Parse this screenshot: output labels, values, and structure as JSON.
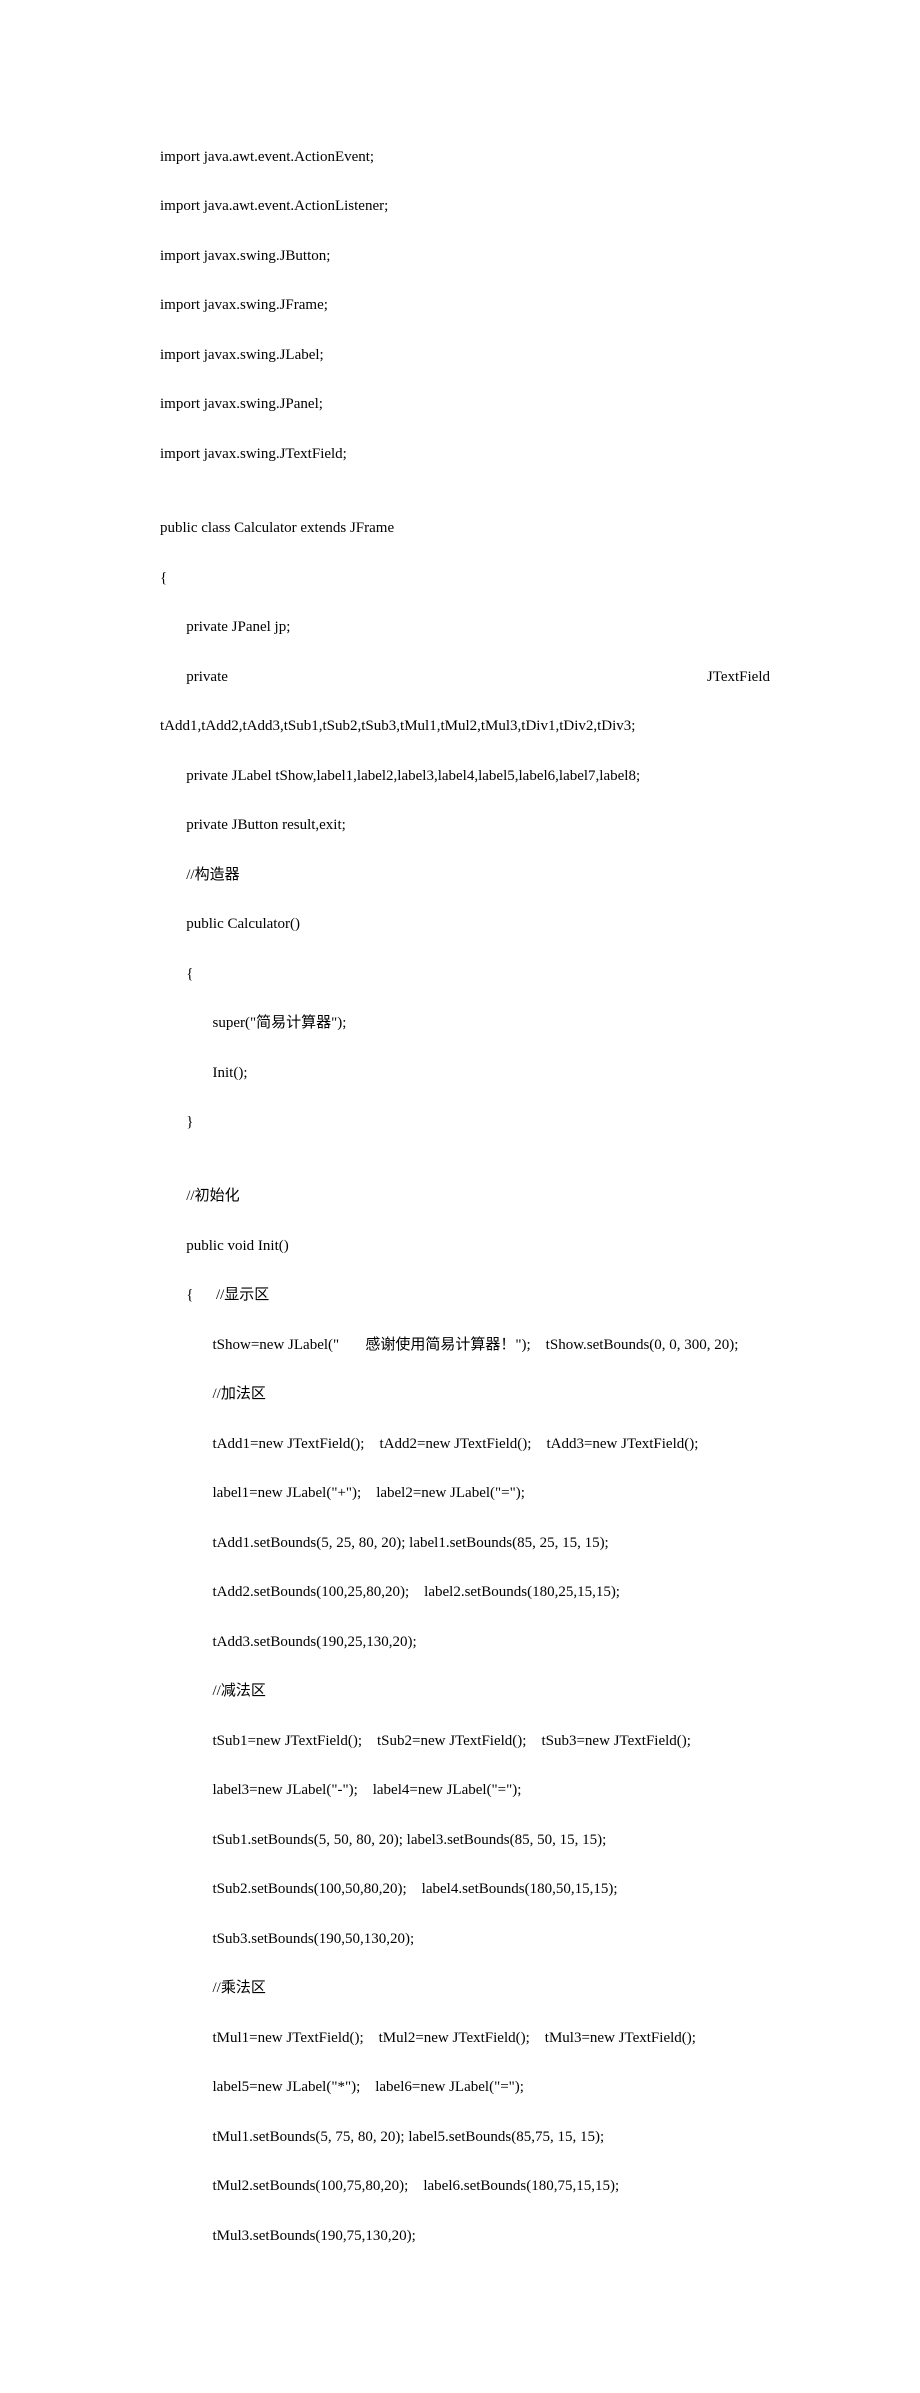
{
  "code": {
    "l1": "import java.awt.event.ActionEvent;",
    "l2": "import java.awt.event.ActionListener;",
    "l3": "import javax.swing.JButton;",
    "l4": "import javax.swing.JFrame;",
    "l5": "import javax.swing.JLabel;",
    "l6": "import javax.swing.JPanel;",
    "l7": "import javax.swing.JTextField;",
    "l8": "",
    "l9": "public class Calculator extends JFrame",
    "l10": "{",
    "l11": "       private JPanel jp;",
    "l12a": "       private",
    "l12b": "JTextField",
    "l13": "tAdd1,tAdd2,tAdd3,tSub1,tSub2,tSub3,tMul1,tMul2,tMul3,tDiv1,tDiv2,tDiv3;",
    "l14": "       private JLabel tShow,label1,label2,label3,label4,label5,label6,label7,label8;",
    "l15": "       private JButton result,exit;",
    "l16": "       //构造器",
    "l17": "       public Calculator()",
    "l18": "       {",
    "l19": "              super(\"简易计算器\");",
    "l20": "              Init();",
    "l21": "       }",
    "l22": "",
    "l23": "       //初始化",
    "l24": "       public void Init()",
    "l25": "       {      //显示区",
    "l26": "              tShow=new JLabel(\"       感谢使用简易计算器！\");    tShow.setBounds(0, 0, 300, 20);",
    "l27": "              //加法区",
    "l28": "              tAdd1=new JTextField();    tAdd2=new JTextField();    tAdd3=new JTextField();",
    "l29": "              label1=new JLabel(\"+\");    label2=new JLabel(\"=\");",
    "l30": "              tAdd1.setBounds(5, 25, 80, 20); label1.setBounds(85, 25, 15, 15);",
    "l31": "              tAdd2.setBounds(100,25,80,20);    label2.setBounds(180,25,15,15);",
    "l32": "              tAdd3.setBounds(190,25,130,20);",
    "l33": "              //减法区",
    "l34": "              tSub1=new JTextField();    tSub2=new JTextField();    tSub3=new JTextField();",
    "l35": "              label3=new JLabel(\"-\");    label4=new JLabel(\"=\");",
    "l36": "              tSub1.setBounds(5, 50, 80, 20); label3.setBounds(85, 50, 15, 15);",
    "l37": "              tSub2.setBounds(100,50,80,20);    label4.setBounds(180,50,15,15);",
    "l38": "              tSub3.setBounds(190,50,130,20);",
    "l39": "              //乘法区",
    "l40": "              tMul1=new JTextField();    tMul2=new JTextField();    tMul3=new JTextField();",
    "l41": "              label5=new JLabel(\"*\");    label6=new JLabel(\"=\");",
    "l42": "              tMul1.setBounds(5, 75, 80, 20); label5.setBounds(85,75, 15, 15);",
    "l43": "              tMul2.setBounds(100,75,80,20);    label6.setBounds(180,75,15,15);",
    "l44": "              tMul3.setBounds(190,75,130,20);"
  }
}
